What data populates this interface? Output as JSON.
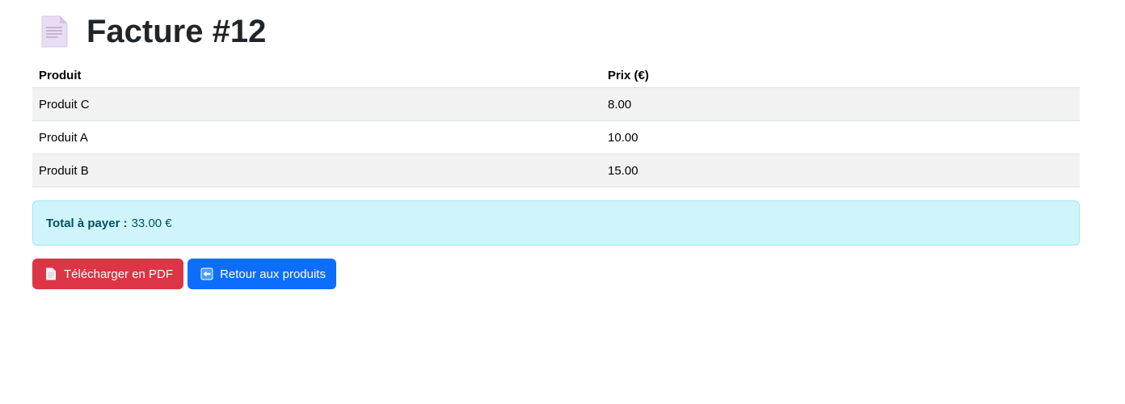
{
  "page": {
    "title": "Facture #12",
    "title_icon": "document-icon"
  },
  "table": {
    "headers": [
      "Produit",
      "Prix (€)"
    ],
    "rows": [
      {
        "produit": "Produit C",
        "prix": "8.00"
      },
      {
        "produit": "Produit A",
        "prix": "10.00"
      },
      {
        "produit": "Produit B",
        "prix": "15.00"
      }
    ]
  },
  "total": {
    "label": "Total à payer :",
    "value": "33.00 €"
  },
  "actions": {
    "pdf_label": "Télécharger en PDF",
    "pdf_icon": "document-icon",
    "back_label": "Retour aux produits",
    "back_icon": "left-arrow-icon"
  },
  "colors": {
    "danger": "#dc3545",
    "primary": "#0d6efd",
    "info_bg": "#cff4fc",
    "info_border": "#9eeaf9",
    "info_text": "#055160"
  }
}
